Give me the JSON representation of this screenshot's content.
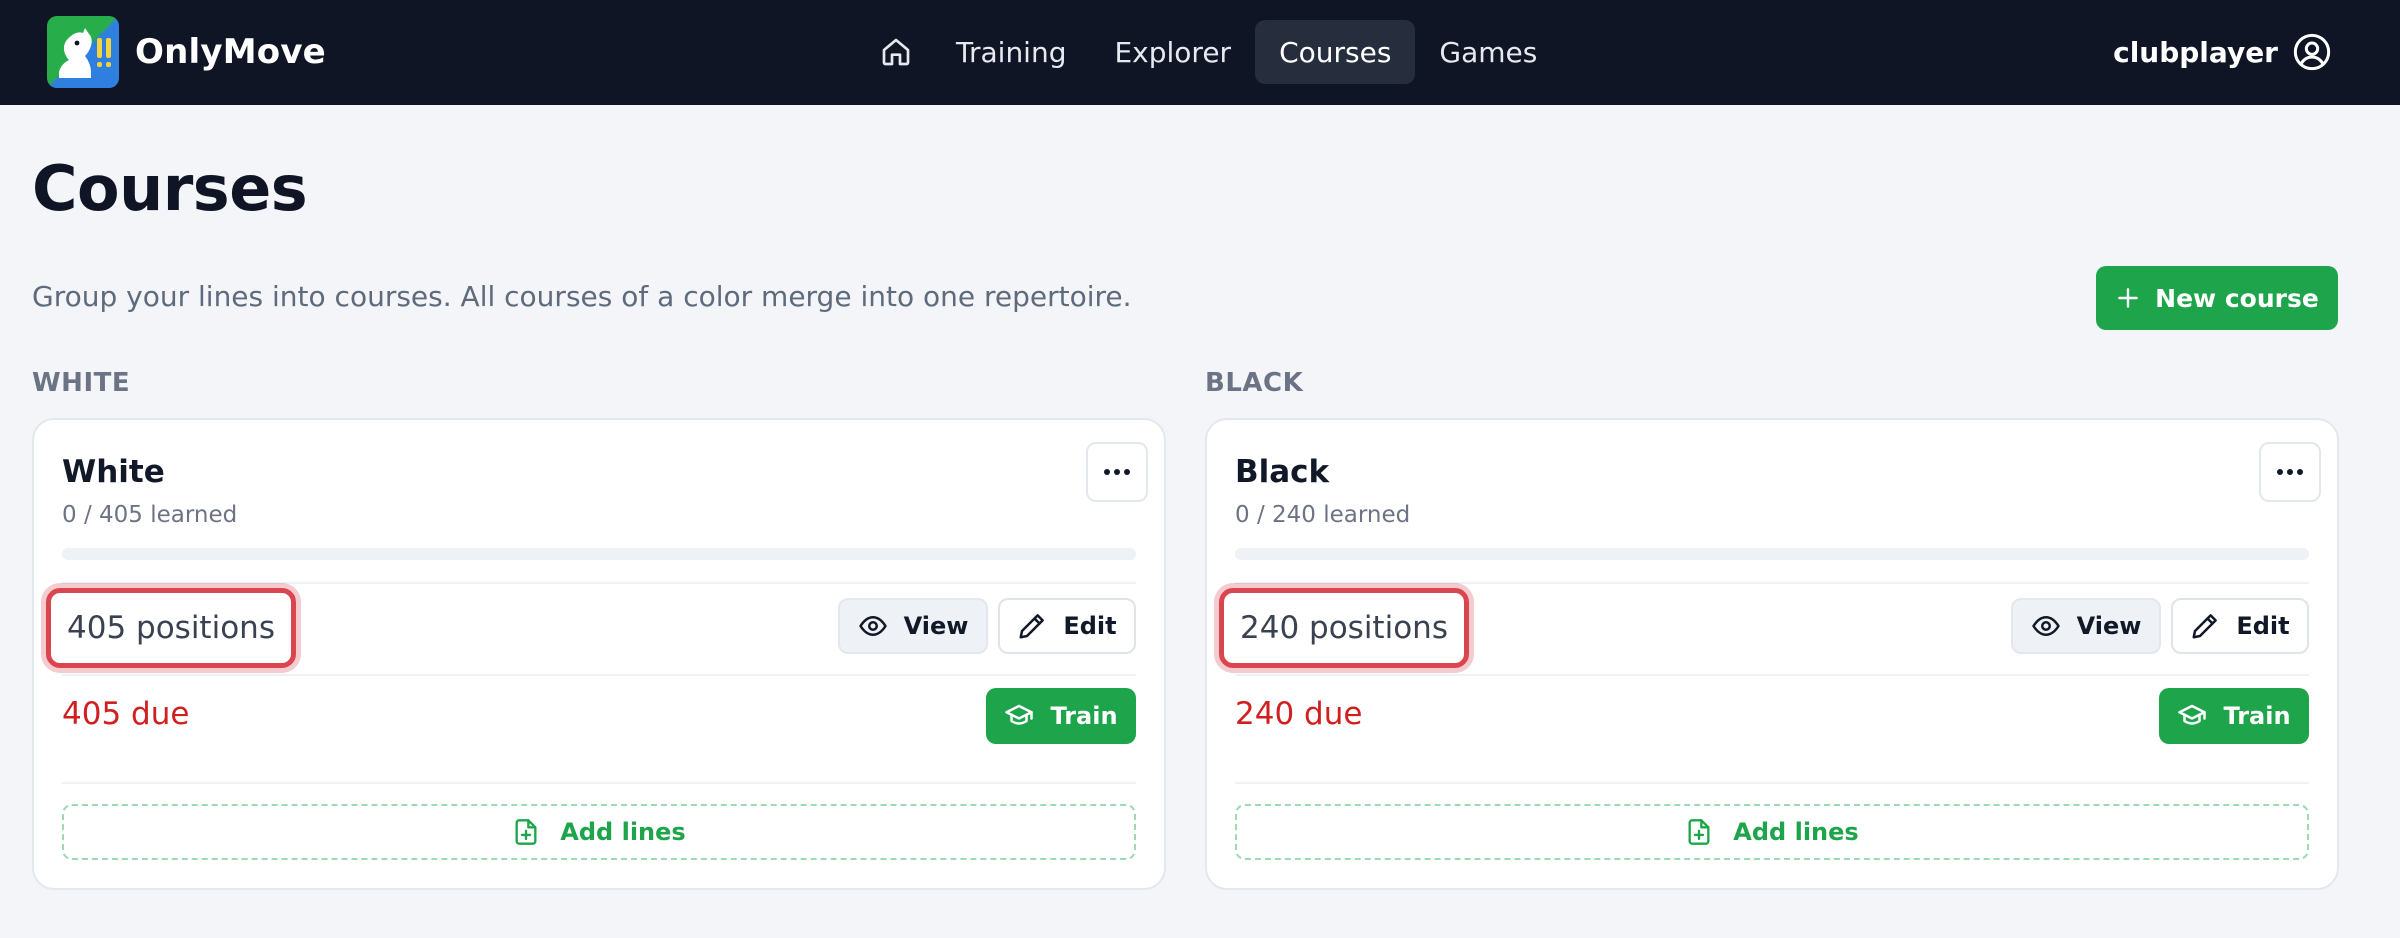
{
  "app": {
    "name": "OnlyMove",
    "logo_icon": "knight-exclamation-logo"
  },
  "nav": {
    "home_icon": "home-icon",
    "items": [
      {
        "label": "Training",
        "active": false
      },
      {
        "label": "Explorer",
        "active": false
      },
      {
        "label": "Courses",
        "active": true
      },
      {
        "label": "Games",
        "active": false
      }
    ]
  },
  "user": {
    "name": "clubplayer",
    "icon": "user-circle-icon"
  },
  "page": {
    "title": "Courses",
    "subtitle": "Group your lines into courses. All courses of a color merge into one repertoire.",
    "new_course_label": "New course"
  },
  "sections": [
    {
      "label": "WHITE",
      "course": {
        "title": "White",
        "learned_text": "0 / 405 learned",
        "learned": 0,
        "total": 405,
        "positions_text": "405 positions",
        "due_text": "405 due",
        "view_label": "View",
        "edit_label": "Edit",
        "train_label": "Train",
        "add_lines_label": "Add lines"
      }
    },
    {
      "label": "BLACK",
      "course": {
        "title": "Black",
        "learned_text": "0 / 240 learned",
        "learned": 0,
        "total": 240,
        "positions_text": "240 positions",
        "due_text": "240 due",
        "view_label": "View",
        "edit_label": "Edit",
        "train_label": "Train",
        "add_lines_label": "Add lines"
      }
    }
  ],
  "colors": {
    "header_bg": "#0f1524",
    "accent_green": "#1ea54b",
    "due_red": "#d11f1f",
    "highlight_red": "#d9464f"
  }
}
